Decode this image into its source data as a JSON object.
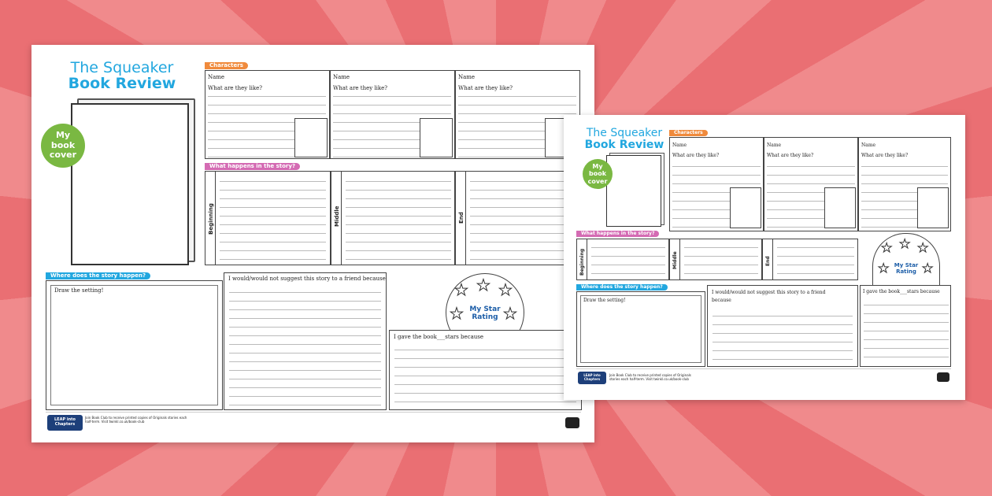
{
  "page": {
    "background_colors": [
      "#ea6f73",
      "#f08a8c"
    ],
    "accent_blue": "#22a7df",
    "accent_orange": "#f08a3c",
    "accent_pink": "#d46bb3",
    "accent_green": "#7ab842"
  },
  "sheet": {
    "title_line1": "The Squeaker",
    "title_line2": "Book Review",
    "cover_badge": "My book cover",
    "characters_heading": "Characters",
    "name_label": "Name",
    "like_label": "What are they like?",
    "story_heading": "What happens in the story?",
    "beginning": "Beginning",
    "middle": "Middle",
    "end": "End",
    "setting_heading": "Where does the story happen?",
    "draw_setting": "Draw the setting!",
    "suggest": "I would/would not suggest this story to a friend because",
    "rating": "My Star Rating",
    "gave_stars": "I gave the book___stars because",
    "footer_text": "Join Book Club to receive printed copies of Originals stories each half-term. Visit twinkl.co.uk/book-club",
    "logo_text": "LEAP into Chapters"
  }
}
